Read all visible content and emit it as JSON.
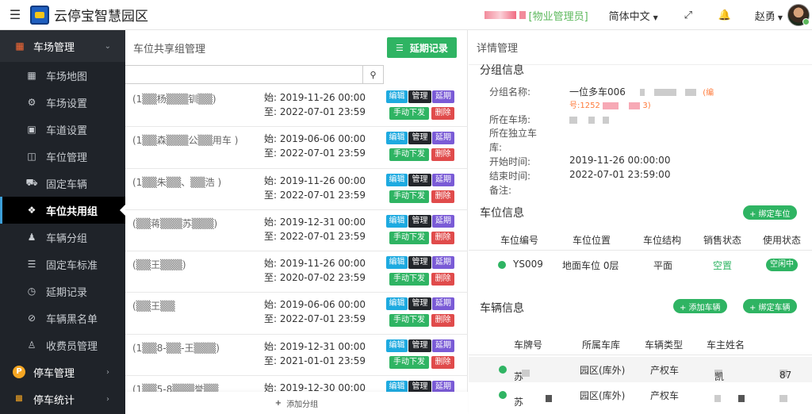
{
  "topbar": {
    "brand": "云停宝智慧园区",
    "role": "[物业管理员]",
    "language": "简体中文",
    "user": "赵勇",
    "icons": {
      "menu": "menu-icon",
      "fullscreen": "expand-icon",
      "notify": "bell-icon"
    }
  },
  "sidebar": {
    "group_main": {
      "label": "车场管理",
      "icon": "windows-icon"
    },
    "items": [
      {
        "label": "车场地图",
        "icon": "map-icon"
      },
      {
        "label": "车场设置",
        "icon": "gear-icon"
      },
      {
        "label": "车道设置",
        "icon": "inbox-icon"
      },
      {
        "label": "车位管理",
        "icon": "columns-icon"
      },
      {
        "label": "固定车辆",
        "icon": "car-icon"
      },
      {
        "label": "车位共用组",
        "icon": "cubes-icon",
        "active": true
      },
      {
        "label": "车辆分组",
        "icon": "users-icon"
      },
      {
        "label": "固定车标准",
        "icon": "list-icon"
      },
      {
        "label": "延期记录",
        "icon": "clock-icon"
      },
      {
        "label": "车辆黑名单",
        "icon": "ban-icon"
      },
      {
        "label": "收费员管理",
        "icon": "user-icon"
      }
    ],
    "group_parking": {
      "label": "停车管理",
      "icon": "p-icon"
    },
    "group_stats": {
      "label": "停车统计",
      "icon": "bar-chart-icon"
    }
  },
  "middle": {
    "title": "车位共享组管理",
    "extend_button": "延期记录",
    "search_placeholder": "",
    "buttons": {
      "edit": "编辑",
      "manage": "管理",
      "extend": "延期",
      "issue": "手动下发",
      "delete": "删除"
    },
    "rows": [
      {
        "name": "(1▒▒杨▒▒▒钏▒▒)",
        "start": "始: 2019-11-26 00:00",
        "end": "至: 2022-07-01 23:59"
      },
      {
        "name": "(1▒▒森▒▒▒公▒▒用车 )",
        "start": "始: 2019-06-06 00:00",
        "end": "至: 2022-07-01 23:59"
      },
      {
        "name": "(1▒▒朱▒▒、▒▒浩 )",
        "start": "始: 2019-11-26 00:00",
        "end": "至: 2022-07-01 23:59"
      },
      {
        "name": "(▒▒蒋▒▒▒苏▒▒▒)",
        "start": "始: 2019-12-31 00:00",
        "end": "至: 2022-07-01 23:59"
      },
      {
        "name": "(▒▒王▒▒▒)",
        "start": "始: 2019-11-26 00:00",
        "end": "至: 2020-07-02 23:59"
      },
      {
        "name": "(▒▒王▒▒",
        "start": "始: 2019-06-06 00:00",
        "end": "至: 2022-07-01 23:59"
      },
      {
        "name": "(1▒▒8-▒▒-王▒▒▒)",
        "start": "始: 2019-12-31 00:00",
        "end": "至: 2021-01-01 23:59"
      },
      {
        "name": "(1▒▒5-8▒▒▒誉▒▒",
        "start": "始: 2019-12-30 00:00",
        "end": ""
      }
    ],
    "add_group": "添加分组"
  },
  "right": {
    "title": "详情管理",
    "group_info": {
      "section": "分组信息",
      "name_label": "分组名称:",
      "name_value": "一位多车006",
      "name_note": "(编",
      "name_note2": "号:1252",
      "name_note3": "3)",
      "lot_label": "所在车场:",
      "garage_label": "所在独立车",
      "garage_label2": "库:",
      "start_label": "开始时间:",
      "start_value": "2019-11-26 00:00:00",
      "end_label": "结束时间:",
      "end_value": "2022-07-01 23:59:00",
      "remark_label": "备注:"
    },
    "space_info": {
      "section": "车位信息",
      "bind_button": "+ 绑定车位",
      "headers": [
        "车位编号",
        "车位位置",
        "车位结构",
        "销售状态",
        "使用状态"
      ],
      "rows": [
        {
          "code": "YS009",
          "location": "地面车位  0层",
          "structure": "平面",
          "sale": "空置",
          "use": "空闲中"
        }
      ]
    },
    "vehicle_info": {
      "section": "车辆信息",
      "add_button": "+ 添加车辆",
      "bind_button": "+ 绑定车辆",
      "headers": [
        "车牌号",
        "所属车库",
        "车辆类型",
        "车主姓名"
      ],
      "rows": [
        {
          "plate": "苏",
          "garage": "园区(库外)",
          "type": "产权车",
          "owner": "凯",
          "extra": "87"
        },
        {
          "plate": "苏",
          "garage": "园区(库外)",
          "type": "产权车",
          "owner": "",
          "extra": ""
        }
      ]
    }
  }
}
